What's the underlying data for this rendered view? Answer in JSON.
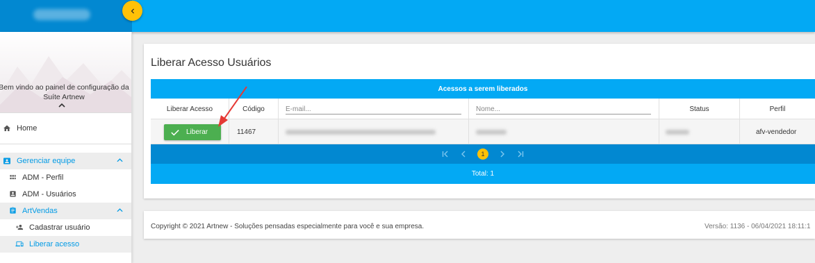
{
  "header": {
    "brand_blurred": "",
    "collapse_icon": "chevron-left-icon"
  },
  "sidebar": {
    "welcome_line1": "Bem vindo ao painel de configuração da",
    "welcome_line2": "Suíte Artnew",
    "items": [
      {
        "label": "Home",
        "icon": "home-icon"
      },
      {
        "label": "Gerenciar equipe",
        "icon": "contact-card-icon"
      },
      {
        "label": "ADM - Perfil",
        "icon": "grid-icon"
      },
      {
        "label": "ADM - Usuários",
        "icon": "account-box-icon"
      },
      {
        "label": "ArtVendas",
        "icon": "clipboard-icon"
      },
      {
        "label": "Cadastrar usuário",
        "icon": "person-add-icon"
      },
      {
        "label": "Liberar acesso",
        "icon": "devices-icon"
      }
    ]
  },
  "main": {
    "title": "Liberar Acesso Usuários",
    "table_title": "Acessos a serem liberados",
    "columns": {
      "liberar": "Liberar Acesso",
      "codigo": "Código",
      "email_placeholder": "E-mail...",
      "nome_placeholder": "Nome...",
      "status": "Status",
      "perfil": "Perfil"
    },
    "rows": [
      {
        "button": "Liberar",
        "codigo": "11467",
        "perfil": "afv-vendedor"
      }
    ],
    "pagination": {
      "current_page": "1"
    },
    "total": "Total: 1"
  },
  "footer": {
    "copyright": "Copyright © 2021 Artnew - Soluções pensadas especialmente para você e sua empresa.",
    "version": "Versão: 1136 - 06/04/2021 18:11:1"
  },
  "colors": {
    "primary": "#03a9f4",
    "primary_dark": "#0288d1",
    "accent": "#ffc107",
    "success": "#4caf50",
    "annotation_arrow": "#e53935"
  }
}
